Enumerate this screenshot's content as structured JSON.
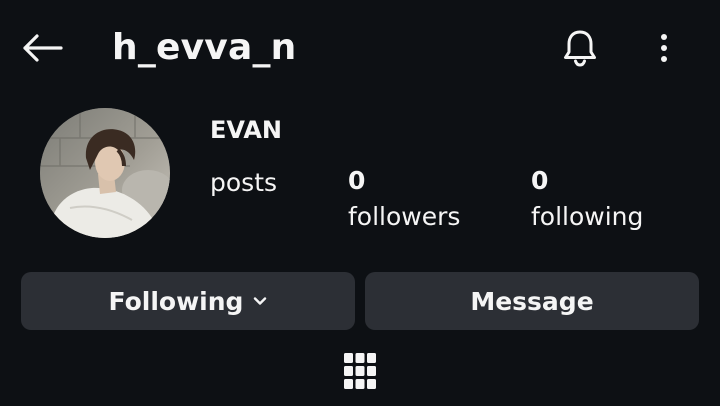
{
  "header": {
    "username": "h_evva_n",
    "back_icon": "arrow-left-icon",
    "notifications_icon": "bell-icon",
    "more_icon": "more-vertical-icon"
  },
  "profile": {
    "display_name": "EVAN",
    "avatar_icon": "profile-photo",
    "stats": {
      "posts": {
        "value": "",
        "label": "posts"
      },
      "followers": {
        "value": "0",
        "label": "followers"
      },
      "following": {
        "value": "0",
        "label": "following"
      }
    }
  },
  "actions": {
    "following_label": "Following",
    "following_icon": "chevron-down-icon",
    "message_label": "Message"
  },
  "tabs": {
    "grid_icon": "grid-icon"
  },
  "colors": {
    "background": "#0d1014",
    "button_bg": "#2c2f35",
    "text": "#f5f5f5"
  }
}
